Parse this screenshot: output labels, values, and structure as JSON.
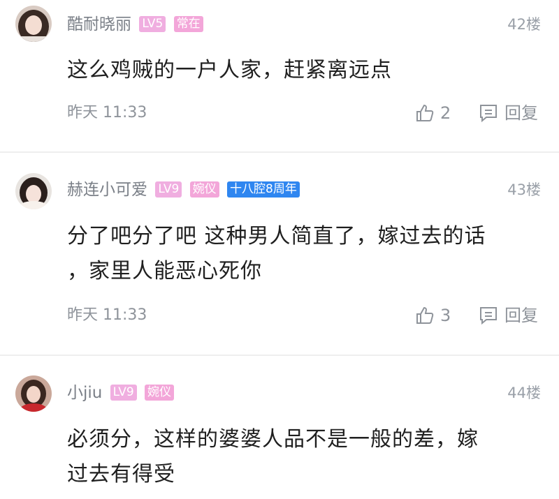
{
  "comments": [
    {
      "username": "酷耐晓丽",
      "badges": [
        {
          "text": "LV5",
          "kind": "lv"
        },
        {
          "text": "常在",
          "kind": "pink"
        }
      ],
      "floor": "42楼",
      "lines": [
        "这么鸡贼的一户人家，赶紧离远点"
      ],
      "time": "昨天 11:33",
      "likes": "2",
      "reply_label": "回复"
    },
    {
      "username": "赫连小可爱",
      "badges": [
        {
          "text": "LV9",
          "kind": "lv"
        },
        {
          "text": "婉仪",
          "kind": "pink"
        },
        {
          "text": "十八腔8周年",
          "kind": "blue"
        }
      ],
      "floor": "43楼",
      "lines": [
        "分了吧分了吧 这种男人简直了，嫁过去的话",
        "，家里人能恶心死你"
      ],
      "time": "昨天 11:33",
      "likes": "3",
      "reply_label": "回复"
    },
    {
      "username": "小jiu",
      "badges": [
        {
          "text": "LV9",
          "kind": "lv"
        },
        {
          "text": "婉仪",
          "kind": "pink"
        }
      ],
      "floor": "44楼",
      "lines": [
        "必须分，这样的婆婆人品不是一般的差，嫁",
        "过去有得受"
      ]
    }
  ],
  "colors": {
    "lv_badge": "#f0aee0",
    "pink_badge": "#f3a6d9",
    "blue_badge": "#2f86f0",
    "meta": "#8e939a"
  },
  "icons": {
    "like": "thumbs-up-icon",
    "reply": "comment-icon"
  }
}
